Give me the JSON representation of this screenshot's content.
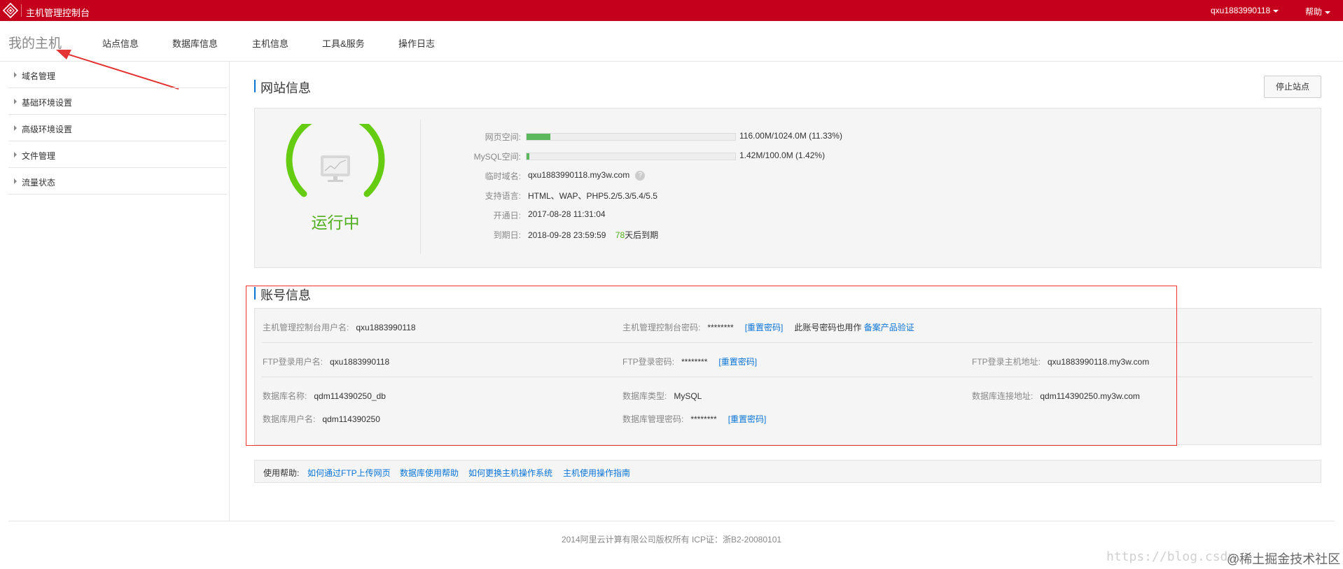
{
  "topbar": {
    "console_title": "主机管理控制台",
    "user": "qxu1883990118",
    "help": "帮助"
  },
  "nav": {
    "brand": "我的主机",
    "items": [
      "站点信息",
      "数据库信息",
      "主机信息",
      "工具&服务",
      "操作日志"
    ]
  },
  "sidebar": {
    "items": [
      "域名管理",
      "基础环境设置",
      "高级环境设置",
      "文件管理",
      "流量状态"
    ]
  },
  "site": {
    "title": "网站信息",
    "stop_button": "停止站点",
    "status": "运行中",
    "rows": {
      "web_space_label": "网页空间:",
      "web_space_value": "116.00M/1024.0M (11.33%)",
      "web_space_fraction": 0.1133,
      "mysql_label": "MySQL空间:",
      "mysql_value": "1.42M/100.0M (1.42%)",
      "mysql_fraction": 0.0142,
      "temp_domain_label": "临时域名:",
      "temp_domain_value": "qxu1883990118.my3w.com",
      "lang_label": "支持语言:",
      "lang_value": "HTML、WAP、PHP5.2/5.3/5.4/5.5",
      "open_label": "开通日:",
      "open_value": "2017-08-28 11:31:04",
      "expire_label": "到期日:",
      "expire_value": "2018-09-28 23:59:59",
      "days_left": "78",
      "days_suffix": "天后到期"
    }
  },
  "account": {
    "title": "账号信息",
    "console_user_label": "主机管理控制台用户名:",
    "console_user_value": "qxu1883990118",
    "console_pwd_label": "主机管理控制台密码:",
    "console_pwd_value": "********",
    "reset_pwd": "[重置密码]",
    "console_pwd_note": "此账号密码也用作",
    "beian_link": "备案产品验证",
    "ftp_user_label": "FTP登录用户名:",
    "ftp_user_value": "qxu1883990118",
    "ftp_pwd_label": "FTP登录密码:",
    "ftp_pwd_value": "********",
    "ftp_host_label": "FTP登录主机地址:",
    "ftp_host_value": "qxu1883990118.my3w.com",
    "db_name_label": "数据库名称:",
    "db_name_value": "qdm114390250_db",
    "db_type_label": "数据库类型:",
    "db_type_value": "MySQL",
    "db_host_label": "数据库连接地址:",
    "db_host_value": "qdm114390250.my3w.com",
    "db_user_label": "数据库用户名:",
    "db_user_value": "qdm114390250",
    "db_pwd_label": "数据库管理密码:",
    "db_pwd_value": "********"
  },
  "help": {
    "label": "使用帮助:",
    "links": [
      "如何通过FTP上传网页",
      "数据库使用帮助",
      "如何更换主机操作系统",
      "主机使用操作指南"
    ]
  },
  "footer": {
    "copyright": "2014阿里云计算有限公司版权所有 ICP证：浙B2-20080101",
    "watermark_url": "https://blog.csdn.",
    "watermark_brand": "@稀土掘金技术社区"
  },
  "colors": {
    "topbar": "#c5001c",
    "accent": "#0a74d8",
    "running": "#4fae1d",
    "progress": "#5cb85c",
    "annotation": "#e33333"
  }
}
